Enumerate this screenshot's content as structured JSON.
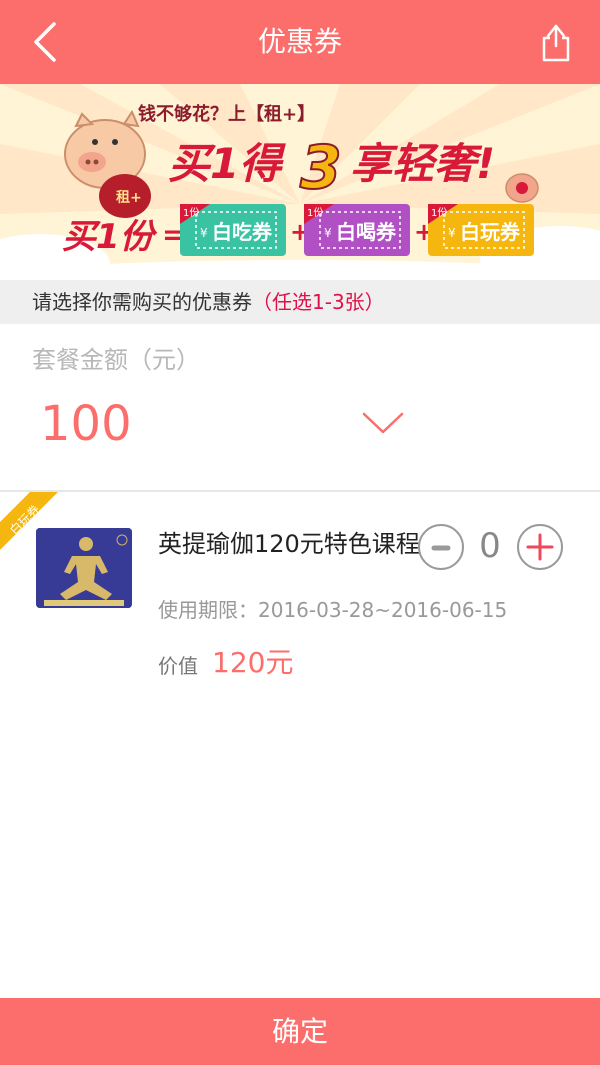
{
  "header": {
    "title": "优惠券",
    "back_icon": "chevron-left-icon",
    "share_icon": "share-icon"
  },
  "banner": {
    "slogan_small": "钱不够花？上【租+】",
    "slogan_main_prefix": "买1得",
    "slogan_main_number": "3",
    "slogan_main_suffix": "享轻奢!",
    "bag_label": "租+",
    "buy_one": "买1份",
    "equals": "=",
    "plus": "+",
    "tickets": [
      {
        "tag": "1份",
        "label": "白吃券",
        "yen": "¥",
        "color": "#3ac3a3"
      },
      {
        "tag": "1份",
        "label": "白喝券",
        "yen": "¥",
        "color": "#b14fc5"
      },
      {
        "tag": "1份",
        "label": "白玩券",
        "yen": "¥",
        "color": "#f5b60f"
      }
    ]
  },
  "hint": {
    "text": "请选择你需购买的优惠券",
    "highlight": "（任选1-3张）"
  },
  "amount": {
    "label": "套餐金额（元）",
    "value": "100",
    "dropdown_icon": "chevron-down-icon"
  },
  "coupon": {
    "corner_tag": "白玩券",
    "title": "英提瑜伽120元特色课程",
    "validity": "使用期限：2016-03-28~2016-06-15",
    "value_label": "价值",
    "value_amount": "120元",
    "quantity": "0",
    "minus_label": "-",
    "plus_label": "+"
  },
  "footer": {
    "confirm_label": "确定"
  },
  "colors": {
    "accent": "#fc6e6b",
    "highlight": "#e0114a"
  }
}
